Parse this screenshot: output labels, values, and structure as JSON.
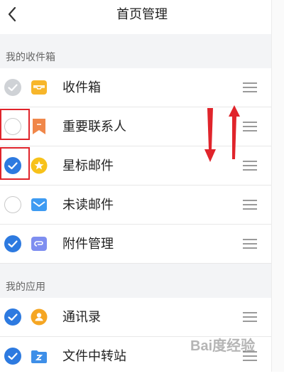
{
  "header": {
    "title": "首页管理"
  },
  "sections": [
    {
      "title": "我的收件箱"
    },
    {
      "title": "我的应用"
    }
  ],
  "rows": [
    {
      "label": "收件箱",
      "state": "locked",
      "icon": "inbox-tray-icon"
    },
    {
      "label": "重要联系人",
      "state": "unchecked",
      "icon": "bookmark-icon"
    },
    {
      "label": "星标邮件",
      "state": "checked",
      "icon": "star-icon"
    },
    {
      "label": "未读邮件",
      "state": "unchecked",
      "icon": "envelope-icon"
    },
    {
      "label": "附件管理",
      "state": "checked",
      "icon": "attachment-icon"
    },
    {
      "label": "通讯录",
      "state": "checked",
      "icon": "contacts-icon"
    },
    {
      "label": "文件中转站",
      "state": "checked",
      "icon": "folder-z-icon"
    }
  ],
  "colors": {
    "accent": "#2d7ae0",
    "highlight_box": "#e0242b",
    "annotation_arrow": "#e0242b"
  },
  "watermark": {
    "text": "Bai度经验"
  }
}
